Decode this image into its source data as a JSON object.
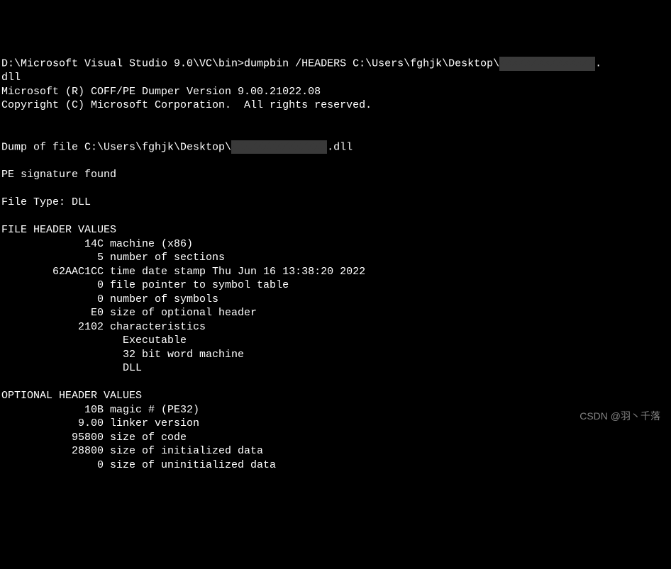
{
  "prompt_line1": "D:\\Microsoft Visual Studio 9.0\\VC\\bin>dumpbin /HEADERS C:\\Users\\fghjk\\Desktop\\",
  "prompt_line1_suffix": ".",
  "prompt_line2": "dll",
  "version_line": "Microsoft (R) COFF/PE Dumper Version 9.00.21022.08",
  "copyright_line": "Copyright (C) Microsoft Corporation.  All rights reserved.",
  "dump_of_file_prefix": "Dump of file C:\\Users\\fghjk\\Desktop\\",
  "dump_of_file_suffix": ".dll",
  "pe_signature": "PE signature found",
  "file_type": "File Type: DLL",
  "file_header_title": "FILE HEADER VALUES",
  "file_header": {
    "machine": "             14C machine (x86)",
    "sections": "               5 number of sections",
    "timestamp": "        62AAC1CC time date stamp Thu Jun 16 13:38:20 2022",
    "symbol_ptr": "               0 file pointer to symbol table",
    "symbol_count": "               0 number of symbols",
    "opt_header_size": "              E0 size of optional header",
    "characteristics": "            2102 characteristics",
    "char_exe": "                   Executable",
    "char_32bit": "                   32 bit word machine",
    "char_dll": "                   DLL"
  },
  "optional_header_title": "OPTIONAL HEADER VALUES",
  "optional_header": {
    "magic": "             10B magic # (PE32)",
    "linker": "            9.00 linker version",
    "code_size": "           95800 size of code",
    "init_data": "           28800 size of initialized data",
    "uninit_data": "               0 size of uninitialized data"
  },
  "watermark": "CSDN @羽丶千落"
}
